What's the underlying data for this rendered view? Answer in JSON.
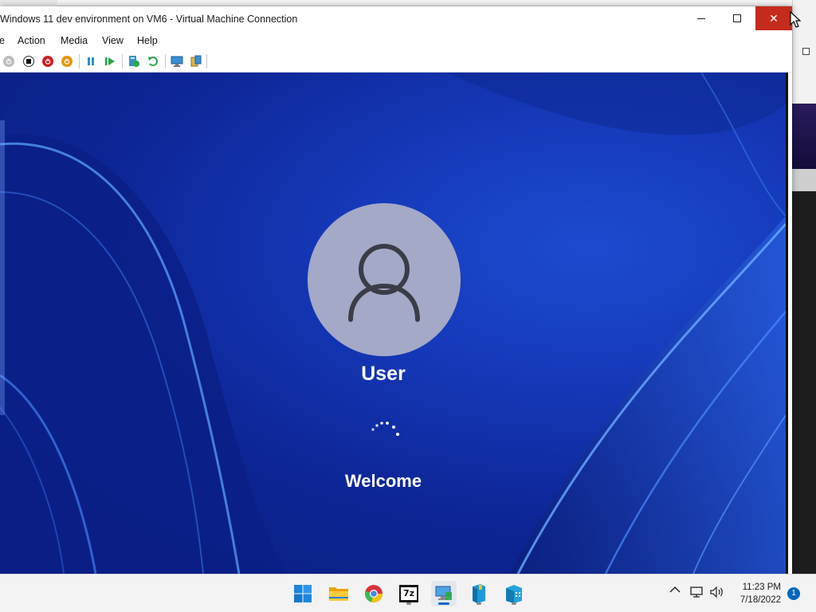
{
  "window": {
    "title": "Windows 11 dev environment on VM6 - Virtual Machine Connection",
    "minimize_glyph": "—",
    "close_glyph": "✕"
  },
  "menu": {
    "items": [
      {
        "label": "e"
      },
      {
        "label": "Action"
      },
      {
        "label": "Media"
      },
      {
        "label": "View"
      },
      {
        "label": "Help"
      }
    ]
  },
  "toolbar": {
    "buttons": [
      {
        "icon": "ctrl-alt-del-icon"
      },
      {
        "icon": "turn-off-icon"
      },
      {
        "icon": "shut-down-icon"
      },
      {
        "icon": "power-icon"
      },
      {
        "icon": "pause-icon"
      },
      {
        "icon": "resume-icon"
      },
      {
        "icon": "checkpoint-icon"
      },
      {
        "icon": "revert-icon"
      },
      {
        "icon": "enhanced-session-icon"
      },
      {
        "icon": "share-icon"
      }
    ]
  },
  "login": {
    "user_name": "User",
    "status": "Welcome"
  },
  "taskbar": {
    "apps": [
      {
        "name": "start",
        "icon": "windows-start-icon"
      },
      {
        "name": "file-explorer",
        "icon": "folder-icon"
      },
      {
        "name": "chrome",
        "icon": "chrome-icon"
      },
      {
        "name": "7zip",
        "icon": "7zip-icon",
        "label": "7z"
      },
      {
        "name": "hyper-v-connection",
        "icon": "vm-connection-icon"
      },
      {
        "name": "app-blue-1",
        "icon": "server-manager-icon"
      },
      {
        "name": "app-blue-2",
        "icon": "building-icon"
      }
    ],
    "tray": {
      "chevron": "^",
      "time": "11:23 PM",
      "date": "7/18/2022",
      "notifications": "1"
    }
  },
  "colors": {
    "close_button": "#c42b1c",
    "wallpaper": "#1538b8",
    "accent": "#0067c0"
  }
}
